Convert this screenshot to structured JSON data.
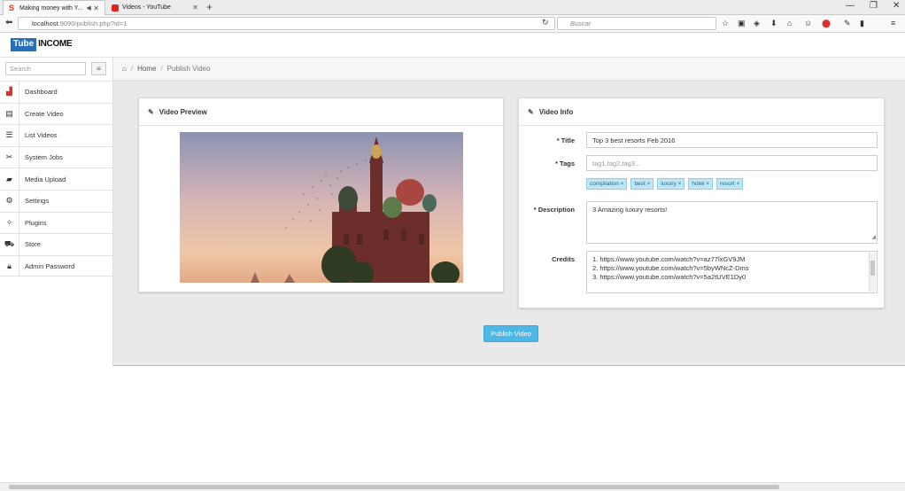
{
  "browser": {
    "tabs": [
      {
        "title": "Making money with Y..."
      },
      {
        "title": "Videos - YouTube"
      }
    ],
    "url_host": "localhost",
    "url_path": ":9090/publish.php?id=1",
    "search_placeholder": "Buscar"
  },
  "app": {
    "logo_part1": "Tube",
    "logo_part2": "INCOME"
  },
  "sidebar": {
    "search_placeholder": "Search",
    "items": [
      {
        "label": "Dashboard",
        "icon": "bar-chart-icon"
      },
      {
        "label": "Create Video",
        "icon": "film-icon"
      },
      {
        "label": "List Videos",
        "icon": "list-icon"
      },
      {
        "label": "System Jobs",
        "icon": "tools-icon"
      },
      {
        "label": "Media Upload",
        "icon": "folder-upload-icon"
      },
      {
        "label": "Settings",
        "icon": "gears-icon"
      },
      {
        "label": "Plugins",
        "icon": "magic-icon"
      },
      {
        "label": "Store",
        "icon": "cart-icon"
      },
      {
        "label": "Admin Password",
        "icon": "lock-icon"
      }
    ]
  },
  "breadcrumb": {
    "home": "Home",
    "current": "Publish Video"
  },
  "preview": {
    "title": "Video Preview"
  },
  "info": {
    "title": "Video Info",
    "title_label": "* Title",
    "title_value": "Top 3 best resorts Feb 2016",
    "tags_label": "* Tags",
    "tags_placeholder": "tag1,tag2,tag3...",
    "tags": [
      "compilation ×",
      "best ×",
      "luxury ×",
      "hotel ×",
      "resort ×"
    ],
    "description_label": "* Description",
    "description_value": "3 Amazing luxury resorts!",
    "credits_label": "Credits",
    "credits": [
      "1. https://www.youtube.com/watch?v=az77lxGV9JM",
      "2. https://www.youtube.com/watch?v=5byWNcZ-Dms",
      "3. https://www.youtube.com/watch?v=5a2tUVE1Dy0"
    ]
  },
  "actions": {
    "publish_label": "Publish Video"
  },
  "colors": {
    "accent": "#4db8e6",
    "logo_blue": "#2a6fb5",
    "tag_bg": "#bfe6f6"
  }
}
